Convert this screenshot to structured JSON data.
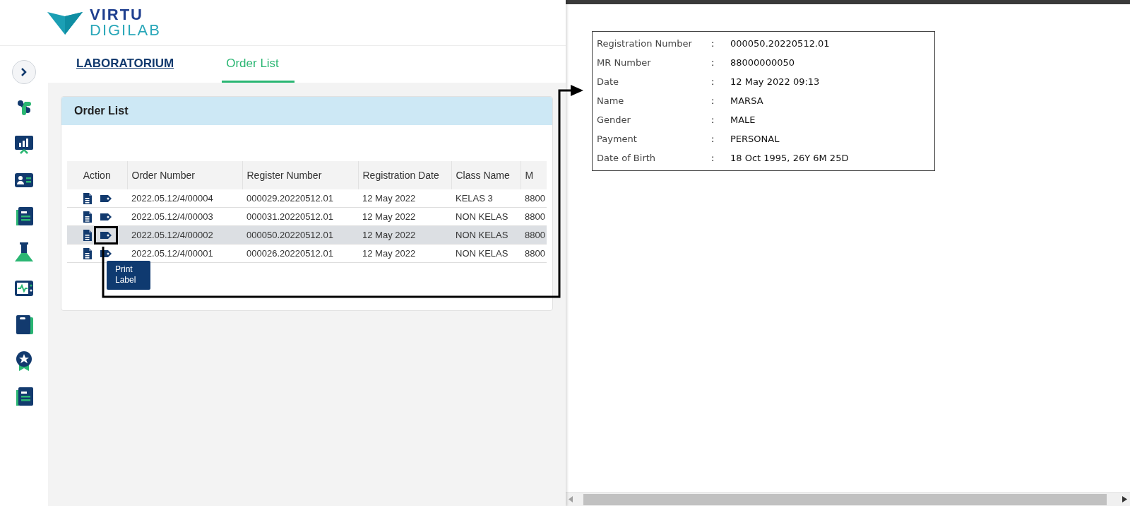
{
  "logo": {
    "line1": "VIRTU",
    "line2": "DIGILAB"
  },
  "tabs": [
    {
      "label": "LABORATORIUM",
      "selected": false
    },
    {
      "label": "Order List",
      "selected": true
    }
  ],
  "card": {
    "title": "Order List",
    "table": {
      "columns": [
        "Action",
        "Order Number",
        "Register Number",
        "Registration Date",
        "Class Name",
        "M"
      ],
      "rows": [
        {
          "cells": [
            "",
            "2022.05.12/4/00004",
            "000029.20220512.01",
            "12 May 2022",
            "KELAS 3",
            "8800"
          ],
          "selected": false,
          "label_highlighted": false
        },
        {
          "cells": [
            "",
            "2022.05.12/4/00003",
            "000031.20220512.01",
            "12 May 2022",
            "NON KELAS",
            "8800"
          ],
          "selected": false,
          "label_highlighted": false
        },
        {
          "cells": [
            "",
            "2022.05.12/4/00002",
            "000050.20220512.01",
            "12 May 2022",
            "NON KELAS",
            "8800"
          ],
          "selected": true,
          "label_highlighted": true
        },
        {
          "cells": [
            "",
            "2022.05.12/4/00001",
            "000026.20220512.01",
            "12 May 2022",
            "NON KELAS",
            "8800"
          ],
          "selected": false,
          "label_highlighted": false
        }
      ]
    },
    "tooltip": "Print Label"
  },
  "label_preview": {
    "rows": [
      {
        "label": "Registration Number",
        "separator": ":",
        "value": "000050.20220512.01"
      },
      {
        "label": "MR Number",
        "separator": ":",
        "value": "88000000050"
      },
      {
        "label": "Date",
        "separator": ":",
        "value": "12 May 2022 09:13"
      },
      {
        "label": "Name",
        "separator": ":",
        "value": "MARSA"
      },
      {
        "label": "Gender",
        "separator": ":",
        "value": "MALE"
      },
      {
        "label": "Payment",
        "separator": ":",
        "value": "PERSONAL"
      },
      {
        "label": "Date of Birth",
        "separator": ":",
        "value": "18 Oct 1995, 26Y 6M 25D"
      }
    ]
  }
}
